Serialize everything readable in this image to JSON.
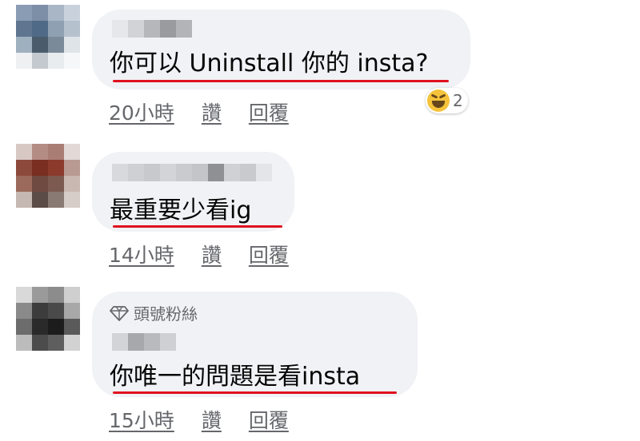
{
  "comments": [
    {
      "text": "你可以 Uninstall 你的 insta?",
      "time": "20小時",
      "like_label": "讚",
      "reply_label": "回覆",
      "reaction": {
        "emoji": "laughing-face-icon",
        "count": "2"
      }
    },
    {
      "text": "最重要少看ig",
      "time": "14小時",
      "like_label": "讚",
      "reply_label": "回覆"
    },
    {
      "badge": "頭號粉絲",
      "text": "你唯一的問題是看insta",
      "time": "15小時",
      "like_label": "讚",
      "reply_label": "回覆"
    }
  ],
  "colors": {
    "bubble": "#f0f2f5",
    "underline": "#e0101e",
    "meta_text": "#65676b"
  }
}
